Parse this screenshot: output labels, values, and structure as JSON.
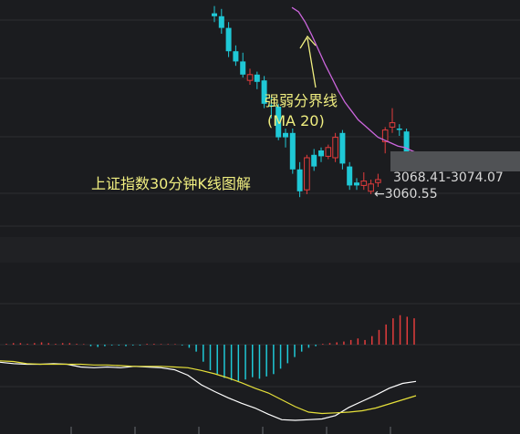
{
  "chart_data": [
    {
      "type": "candlestick",
      "annotation_title": "上证指数30分钟K线图解",
      "ma_label_line1": "强弱分界线",
      "ma_label_line2": "(MA 20)",
      "zone_label": "3068.41-3074.07",
      "low_label": "←3060.55",
      "ma_name": "MA 20",
      "colors": {
        "up": "#e23c3c",
        "down": "#1fc8d6",
        "ma": "#cc66dd",
        "annotation": "#f0ee80",
        "zone": "#505255"
      },
      "candles": [
        {
          "o": 3182,
          "h": 3187,
          "l": 3176,
          "c": 3180,
          "d": "down"
        },
        {
          "o": 3180,
          "h": 3185,
          "l": 3168,
          "c": 3172,
          "d": "down"
        },
        {
          "o": 3172,
          "h": 3176,
          "l": 3152,
          "c": 3156,
          "d": "down"
        },
        {
          "o": 3156,
          "h": 3160,
          "l": 3146,
          "c": 3149,
          "d": "down"
        },
        {
          "o": 3149,
          "h": 3155,
          "l": 3138,
          "c": 3140,
          "d": "down"
        },
        {
          "o": 3136,
          "h": 3144,
          "l": 3133,
          "c": 3140,
          "d": "up"
        },
        {
          "o": 3140,
          "h": 3142,
          "l": 3130,
          "c": 3135,
          "d": "down"
        },
        {
          "o": 3136,
          "h": 3139,
          "l": 3117,
          "c": 3120,
          "d": "down"
        },
        {
          "o": 3119,
          "h": 3125,
          "l": 3110,
          "c": 3118,
          "d": "down"
        },
        {
          "o": 3118,
          "h": 3120,
          "l": 3095,
          "c": 3097,
          "d": "down"
        },
        {
          "o": 3097,
          "h": 3103,
          "l": 3090,
          "c": 3100,
          "d": "down"
        },
        {
          "o": 3100,
          "h": 3103,
          "l": 3072,
          "c": 3075,
          "d": "down"
        },
        {
          "o": 3075,
          "h": 3080,
          "l": 3056,
          "c": 3060,
          "d": "down"
        },
        {
          "o": 3061,
          "h": 3085,
          "l": 3058,
          "c": 3083,
          "d": "up"
        },
        {
          "o": 3077,
          "h": 3089,
          "l": 3074,
          "c": 3085,
          "d": "down"
        },
        {
          "o": 3088,
          "h": 3090,
          "l": 3080,
          "c": 3084,
          "d": "down"
        },
        {
          "o": 3084,
          "h": 3092,
          "l": 3082,
          "c": 3090,
          "d": "up"
        },
        {
          "o": 3083,
          "h": 3100,
          "l": 3080,
          "c": 3097,
          "d": "up"
        },
        {
          "o": 3100,
          "h": 3102,
          "l": 3075,
          "c": 3079,
          "d": "down"
        },
        {
          "o": 3077,
          "h": 3080,
          "l": 3061,
          "c": 3064,
          "d": "down"
        },
        {
          "o": 3064,
          "h": 3069,
          "l": 3061,
          "c": 3066,
          "d": "down"
        },
        {
          "o": 3064,
          "h": 3073,
          "l": 3061,
          "c": 3067,
          "d": "up"
        },
        {
          "o": 3060,
          "h": 3068,
          "l": 3058,
          "c": 3065,
          "d": "up"
        },
        {
          "o": 3066,
          "h": 3072,
          "l": 3063,
          "c": 3068,
          "d": "up"
        },
        {
          "o": 3094,
          "h": 3104,
          "l": 3086,
          "c": 3102,
          "d": "up"
        },
        {
          "o": 3104,
          "h": 3117,
          "l": 3100,
          "c": 3107,
          "d": "up"
        },
        {
          "o": 3103,
          "h": 3106,
          "l": 3098,
          "c": 3103,
          "d": "down"
        },
        {
          "o": 3101,
          "h": 3103,
          "l": 3082,
          "c": 3085,
          "d": "down"
        }
      ],
      "ma20": [
        3186,
        3183,
        3176,
        3167,
        3157,
        3147,
        3138,
        3129,
        3121,
        3115,
        3109,
        3105,
        3101,
        3097,
        3095,
        3093,
        3091,
        3090,
        3088,
        3086
      ]
    },
    {
      "type": "bar",
      "name": "MACD histogram",
      "colors": {
        "up": "#e23c3c",
        "down": "#1fc8d6"
      },
      "values": [
        0.1,
        0.2,
        0.2,
        0.1,
        0.2,
        0.3,
        0.2,
        0.1,
        0.2,
        0.2,
        0.1,
        0,
        -0.2,
        -0.3,
        -0.2,
        -0.1,
        -0.1,
        -0.2,
        -0.1,
        -0.1,
        0.1,
        0.1,
        0,
        0,
        0,
        -0.1,
        -0.4,
        -0.9,
        -2.2,
        -3.3,
        -3.8,
        -4.3,
        -4.6,
        -4.7,
        -4.5,
        -4.2,
        -4.4,
        -4.1,
        -3.8,
        -3.1,
        -2.4,
        -1.6,
        -0.9,
        -0.4,
        -0.2,
        0.1,
        0.2,
        0.3,
        0.4,
        0.6,
        0.8,
        0.6,
        1.1,
        1.9,
        2.6,
        3.4,
        3.8,
        3.6,
        3.4
      ],
      "dif": [
        -0.3,
        -0.5,
        -0.6,
        -0.6,
        -0.5,
        -0.6,
        -1.0,
        -1.1,
        -1.0,
        -1.1,
        -0.9,
        -1.0,
        -1.1,
        -1.4,
        -2.2,
        -3.6,
        -4.6,
        -5.5,
        -6.3,
        -7.0,
        -7.9,
        -8.7,
        -8.8,
        -8.7,
        -8.6,
        -8.1,
        -6.9,
        -6.0,
        -5.1,
        -4.1,
        -3.4,
        -3.1
      ],
      "dea": [
        -0.1,
        -0.2,
        -0.5,
        -0.6,
        -0.6,
        -0.6,
        -0.6,
        -0.7,
        -0.7,
        -0.8,
        -0.9,
        -0.9,
        -0.9,
        -1.0,
        -1.1,
        -1.5,
        -2.0,
        -2.6,
        -3.3,
        -4.1,
        -4.8,
        -5.8,
        -6.8,
        -7.6,
        -7.8,
        -7.7,
        -7.6,
        -7.4,
        -7.0,
        -6.4,
        -5.8,
        -5.2
      ]
    }
  ]
}
